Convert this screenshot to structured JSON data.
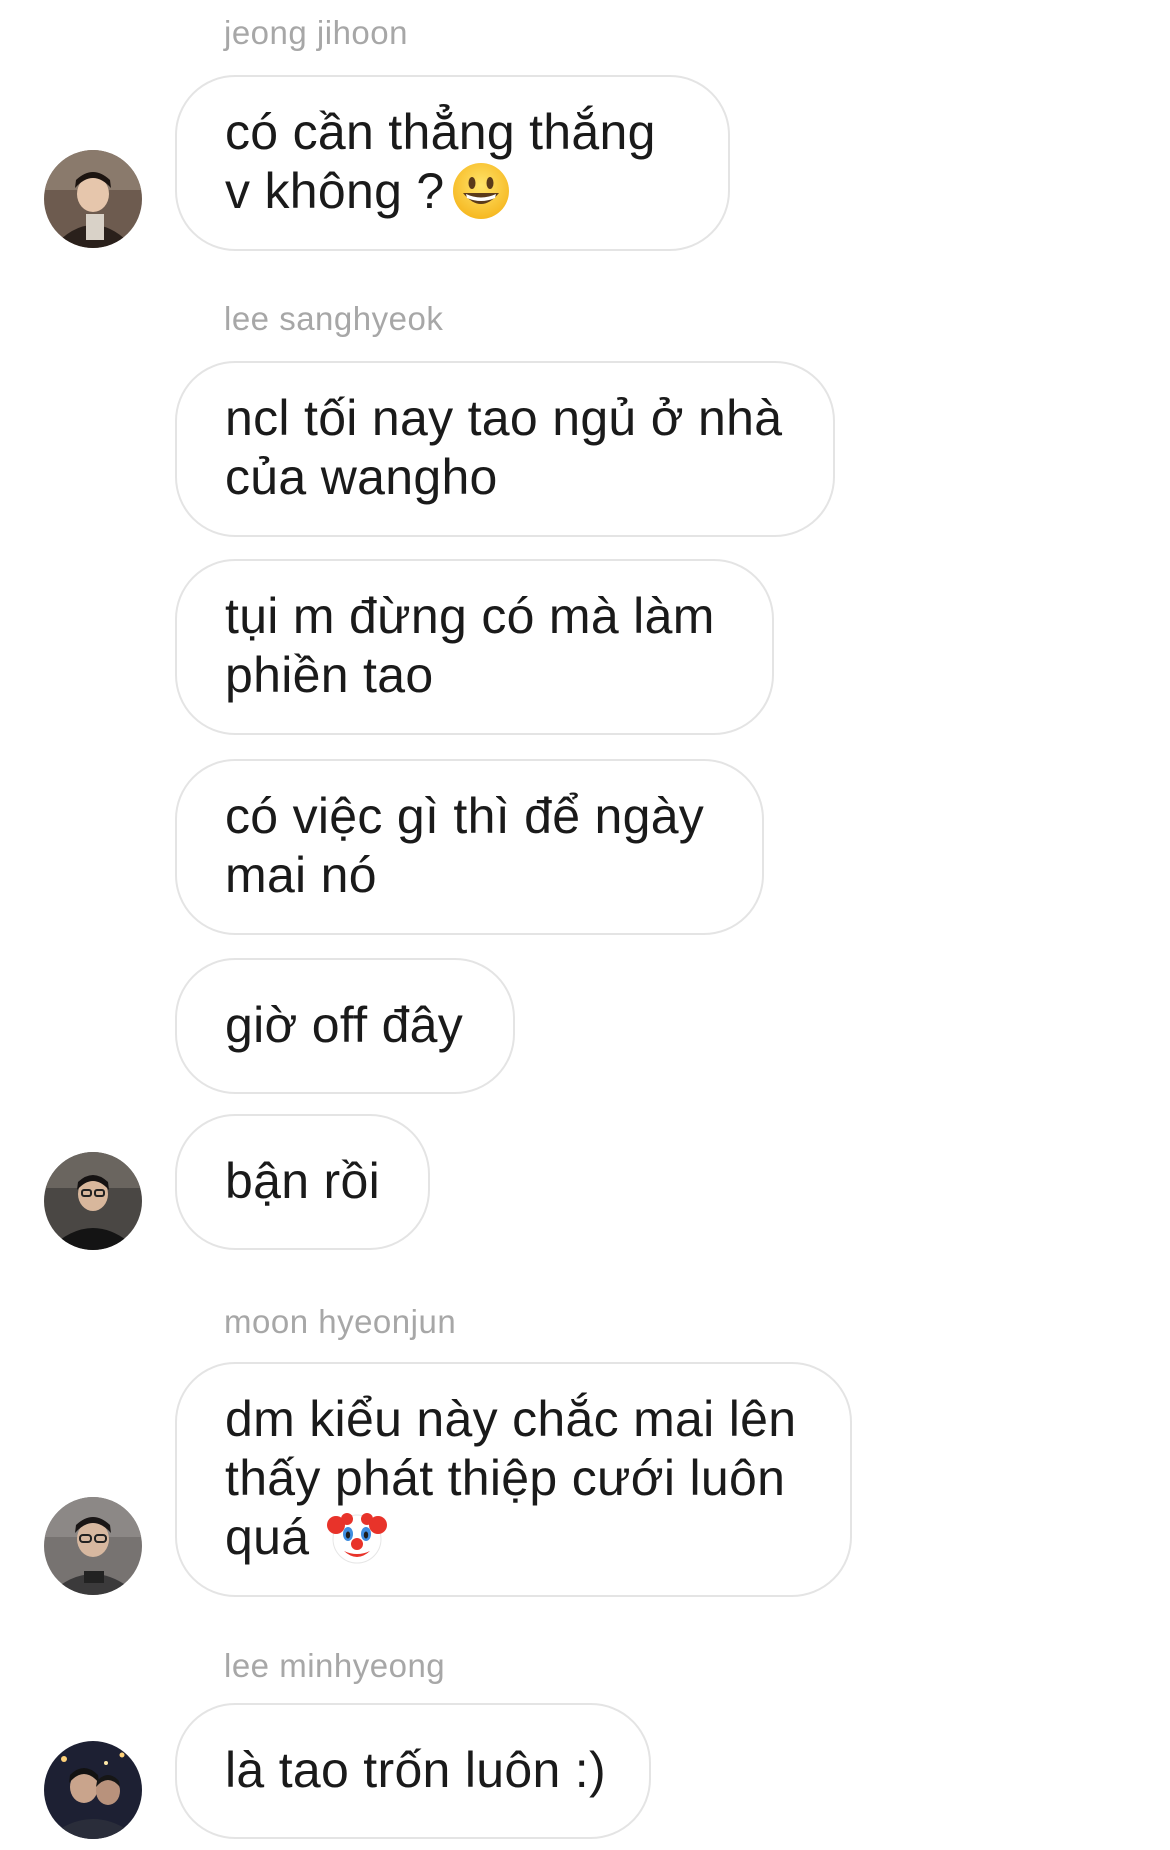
{
  "messages": {
    "g1_name": "jeong jihoon",
    "g1_b1_l1": "có cần thẳng thắng",
    "g1_b1_l2": "v không ?",
    "g1_b1_emoji": "grinning-face-emoji",
    "g2_name": "lee sanghyeok",
    "g2_b1_l1": "ncl tối nay tao ngủ ở nhà",
    "g2_b1_l2": "của wangho",
    "g2_b2_l1": "tụi m đừng có mà làm",
    "g2_b2_l2": "phiền tao",
    "g2_b3_l1": "có việc gì thì để ngày",
    "g2_b3_l2": "mai nó",
    "g2_b4_l1": "giờ off đây",
    "g2_b5_l1": "bận rồi",
    "g3_name": "moon hyeonjun",
    "g3_b1_l1": "dm kiểu này chắc mai lên",
    "g3_b1_l2": "thấy phát thiệp cưới luôn",
    "g3_b1_l3": "quá",
    "g3_b1_emoji": "clown-face-emoji",
    "g4_name": "lee minhyeong",
    "g4_b1_l1": "là tao trốn luôn :)"
  },
  "avatars": {
    "jeong_jihoon": "avatar-photo",
    "lee_sanghyeok": "avatar-photo",
    "moon_hyeonjun": "avatar-photo",
    "lee_minhyeong": "avatar-photo"
  },
  "colors": {
    "bubble_border": "#e4e4e4",
    "sender_name": "#a7a7a7",
    "message_text": "#1a1a1a",
    "background": "#ffffff"
  }
}
